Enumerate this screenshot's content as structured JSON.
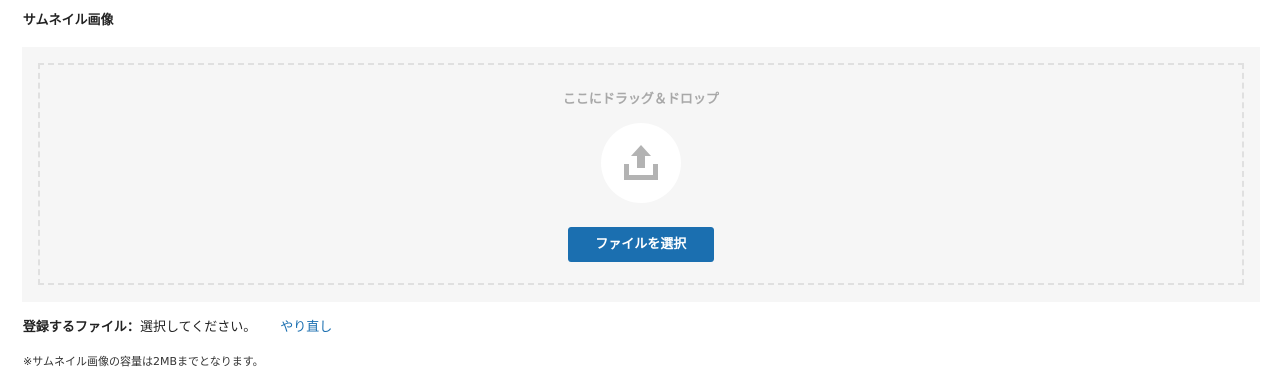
{
  "section": {
    "title": "サムネイル画像"
  },
  "dropzone": {
    "hint": "ここにドラッグ＆ドロップ",
    "icon": "upload-icon",
    "select_button_label": "ファイルを選択"
  },
  "file_status": {
    "label": "登録するファイル：",
    "value": "選択してください。",
    "redo_label": "やり直し"
  },
  "note": "※サムネイル画像の容量は2MBまでとなります。",
  "colors": {
    "accent": "#1b6fb0",
    "panel_background": "#f6f6f6",
    "dashed_border": "#e0e0e0",
    "icon_gray": "#b3b3b3"
  }
}
